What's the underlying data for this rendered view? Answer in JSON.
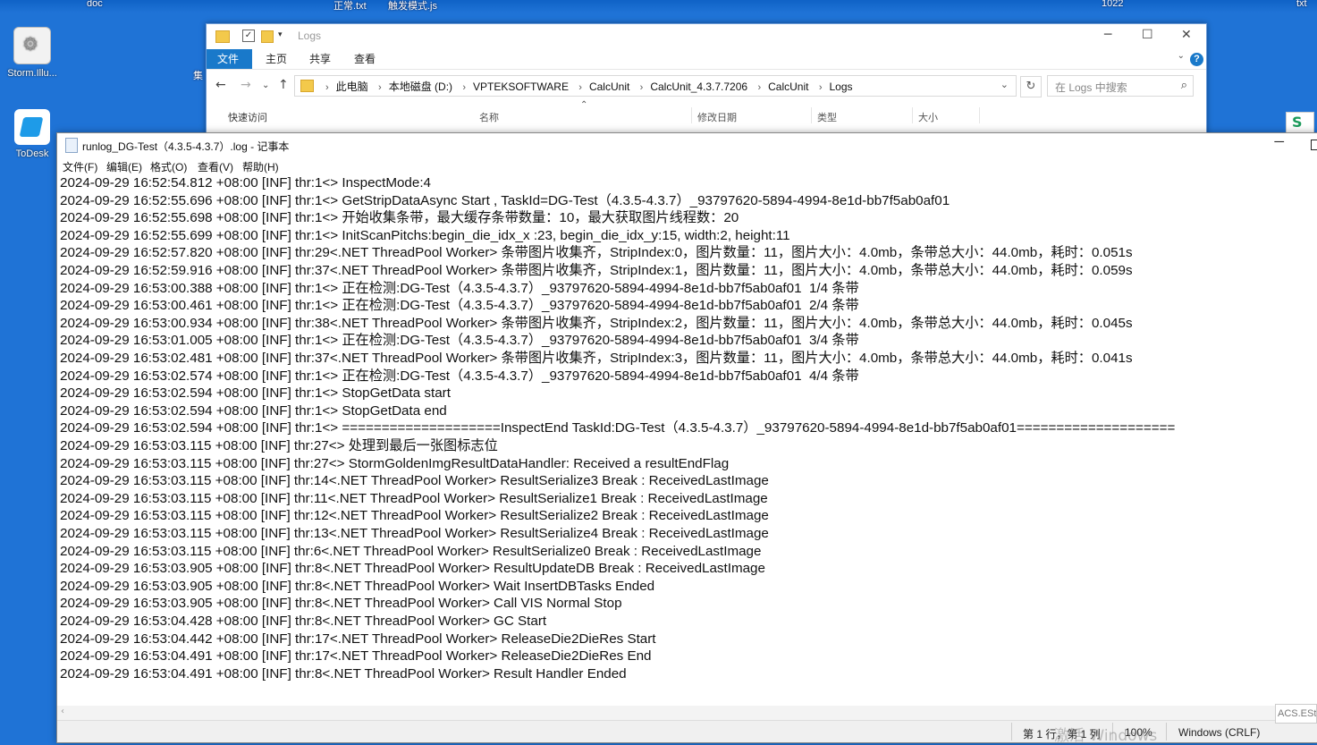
{
  "desktop": {
    "top_labels": [
      "doc",
      "正常.txt",
      "触发模式.js",
      "1022",
      "txt"
    ],
    "icons": [
      {
        "label": "Storm.Illu..."
      },
      {
        "label": "ToDesk"
      }
    ],
    "partial_label": "集"
  },
  "explorer": {
    "title": "Logs",
    "ribbon_tabs": [
      "文件",
      "主页",
      "共享",
      "查看"
    ],
    "breadcrumb": [
      "此电脑",
      "本地磁盘 (D:)",
      "VPTEKSOFTWARE",
      "CalcUnit",
      "CalcUnit_4.3.7.7206",
      "CalcUnit",
      "Logs"
    ],
    "search_placeholder": "在 Logs 中搜索",
    "columns": [
      "名称",
      "修改日期",
      "类型",
      "大小"
    ],
    "quick_access": "快速访问"
  },
  "notepad": {
    "title": "runlog_DG-Test（4.3.5-4.3.7）.log - 记事本",
    "menu": [
      "文件(F)",
      "编辑(E)",
      "格式(O)",
      "查看(V)",
      "帮助(H)"
    ],
    "lines": [
      "2024-09-29 16:52:54.812 +08:00 [INF] thr:1<> InspectMode:4",
      "2024-09-29 16:52:55.696 +08:00 [INF] thr:1<> GetStripDataAsync Start , TaskId=DG-Test（4.3.5-4.3.7）_93797620-5894-4994-8e1d-bb7f5ab0af01",
      "2024-09-29 16:52:55.698 +08:00 [INF] thr:1<> 开始收集条带，最大缓存条带数量：10，最大获取图片线程数：20",
      "2024-09-29 16:52:55.699 +08:00 [INF] thr:1<> InitScanPitchs:begin_die_idx_x :23, begin_die_idx_y:15, width:2, height:11",
      "2024-09-29 16:52:57.820 +08:00 [INF] thr:29<.NET ThreadPool Worker> 条带图片收集齐，StripIndex:0，图片数量：11，图片大小：4.0mb，条带总大小：44.0mb，耗时：0.051s",
      "2024-09-29 16:52:59.916 +08:00 [INF] thr:37<.NET ThreadPool Worker> 条带图片收集齐，StripIndex:1，图片数量：11，图片大小：4.0mb，条带总大小：44.0mb，耗时：0.059s",
      "2024-09-29 16:53:00.388 +08:00 [INF] thr:1<> 正在检测:DG-Test（4.3.5-4.3.7）_93797620-5894-4994-8e1d-bb7f5ab0af01  1/4 条带",
      "2024-09-29 16:53:00.461 +08:00 [INF] thr:1<> 正在检测:DG-Test（4.3.5-4.3.7）_93797620-5894-4994-8e1d-bb7f5ab0af01  2/4 条带",
      "2024-09-29 16:53:00.934 +08:00 [INF] thr:38<.NET ThreadPool Worker> 条带图片收集齐，StripIndex:2，图片数量：11，图片大小：4.0mb，条带总大小：44.0mb，耗时：0.045s",
      "2024-09-29 16:53:01.005 +08:00 [INF] thr:1<> 正在检测:DG-Test（4.3.5-4.3.7）_93797620-5894-4994-8e1d-bb7f5ab0af01  3/4 条带",
      "2024-09-29 16:53:02.481 +08:00 [INF] thr:37<.NET ThreadPool Worker> 条带图片收集齐，StripIndex:3，图片数量：11，图片大小：4.0mb，条带总大小：44.0mb，耗时：0.041s",
      "2024-09-29 16:53:02.574 +08:00 [INF] thr:1<> 正在检测:DG-Test（4.3.5-4.3.7）_93797620-5894-4994-8e1d-bb7f5ab0af01  4/4 条带",
      "2024-09-29 16:53:02.594 +08:00 [INF] thr:1<> StopGetData start",
      "2024-09-29 16:53:02.594 +08:00 [INF] thr:1<> StopGetData end",
      "2024-09-29 16:53:02.594 +08:00 [INF] thr:1<> ====================InspectEnd TaskId:DG-Test（4.3.5-4.3.7）_93797620-5894-4994-8e1d-bb7f5ab0af01====================",
      "2024-09-29 16:53:03.115 +08:00 [INF] thr:27<> 处理到最后一张图标志位",
      "2024-09-29 16:53:03.115 +08:00 [INF] thr:27<> StormGoldenImgResultDataHandler: Received a resultEndFlag",
      "2024-09-29 16:53:03.115 +08:00 [INF] thr:14<.NET ThreadPool Worker> ResultSerialize3 Break : ReceivedLastImage",
      "2024-09-29 16:53:03.115 +08:00 [INF] thr:11<.NET ThreadPool Worker> ResultSerialize1 Break : ReceivedLastImage",
      "2024-09-29 16:53:03.115 +08:00 [INF] thr:12<.NET ThreadPool Worker> ResultSerialize2 Break : ReceivedLastImage",
      "2024-09-29 16:53:03.115 +08:00 [INF] thr:13<.NET ThreadPool Worker> ResultSerialize4 Break : ReceivedLastImage",
      "2024-09-29 16:53:03.115 +08:00 [INF] thr:6<.NET ThreadPool Worker> ResultSerialize0 Break : ReceivedLastImage",
      "2024-09-29 16:53:03.905 +08:00 [INF] thr:8<.NET ThreadPool Worker> ResultUpdateDB Break : ReceivedLastImage",
      "2024-09-29 16:53:03.905 +08:00 [INF] thr:8<.NET ThreadPool Worker> Wait InsertDBTasks Ended",
      "2024-09-29 16:53:03.905 +08:00 [INF] thr:8<.NET ThreadPool Worker> Call VIS Normal Stop",
      "2024-09-29 16:53:04.428 +08:00 [INF] thr:8<.NET ThreadPool Worker> GC Start",
      "2024-09-29 16:53:04.442 +08:00 [INF] thr:17<.NET ThreadPool Worker> ReleaseDie2DieRes Start",
      "2024-09-29 16:53:04.491 +08:00 [INF] thr:17<.NET ThreadPool Worker> ReleaseDie2DieRes End",
      "2024-09-29 16:53:04.491 +08:00 [INF] thr:8<.NET ThreadPool Worker> Result Handler Ended"
    ],
    "status": {
      "position": "第 1 行，第 1 列",
      "zoom": "100%",
      "encoding": "Windows (CRLF)"
    }
  },
  "overlay": {
    "activate_watermark": "激活 Windows",
    "acs_label": "ACS.ESto"
  }
}
